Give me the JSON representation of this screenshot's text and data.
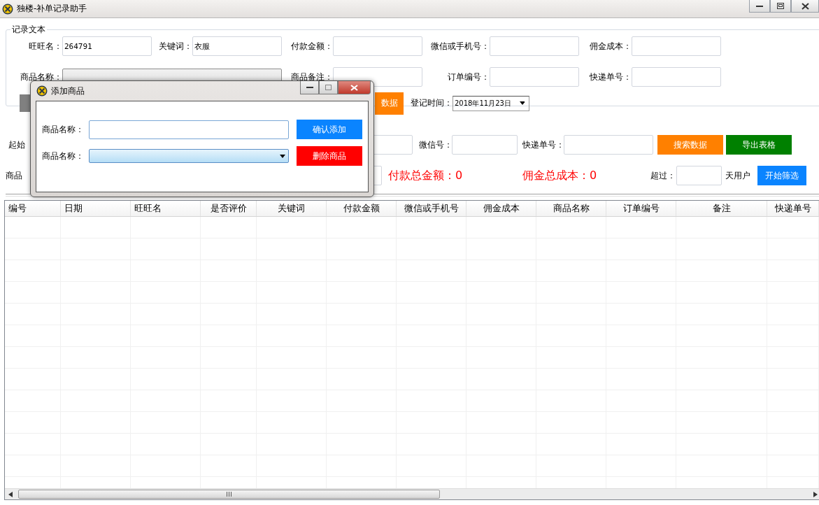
{
  "window": {
    "title": "独楼-补单记录助手"
  },
  "record_group": {
    "title": "记录文本",
    "row1": [
      {
        "label": "旺旺名：",
        "value": "264791"
      },
      {
        "label": "关键词：",
        "value": "衣服"
      },
      {
        "label": "付款金额："
      },
      {
        "label": "微信或手机号："
      },
      {
        "label": "佣金成本："
      }
    ],
    "row2": [
      {
        "label": "商品名称：",
        "kind": "combo"
      },
      {
        "label": "商品备注：",
        "kind": "text"
      },
      {
        "label": "订单编号：",
        "kind": "text"
      },
      {
        "label": "快递单号：",
        "kind": "text"
      }
    ],
    "partial_button": "数据",
    "date_label": "登记时间：",
    "date_value": "2018年11月23日"
  },
  "search": {
    "start_label": "起始",
    "wechat_label": "微信号：",
    "express_label": "快递单号：",
    "search_button": "搜索数据",
    "export_button": "导出表格"
  },
  "summary": {
    "product_label": "商品",
    "pay_total": "付款总金额：0",
    "commission_total": "佣金总成本：0",
    "over_label": "超过：",
    "days_label": "天用户",
    "filter_button": "开始筛选"
  },
  "table": {
    "columns": [
      "编号",
      "日期",
      "旺旺名",
      "是否评价",
      "关键词",
      "付款金额",
      "微信或手机号",
      "佣金成本",
      "商品名称",
      "订单编号",
      "备注",
      "快递单号"
    ]
  },
  "dialog": {
    "title": "添加商品",
    "name_label": "商品名称：",
    "combo_label": "商品名称：",
    "confirm_button": "确认添加",
    "delete_button": "删除商品"
  }
}
